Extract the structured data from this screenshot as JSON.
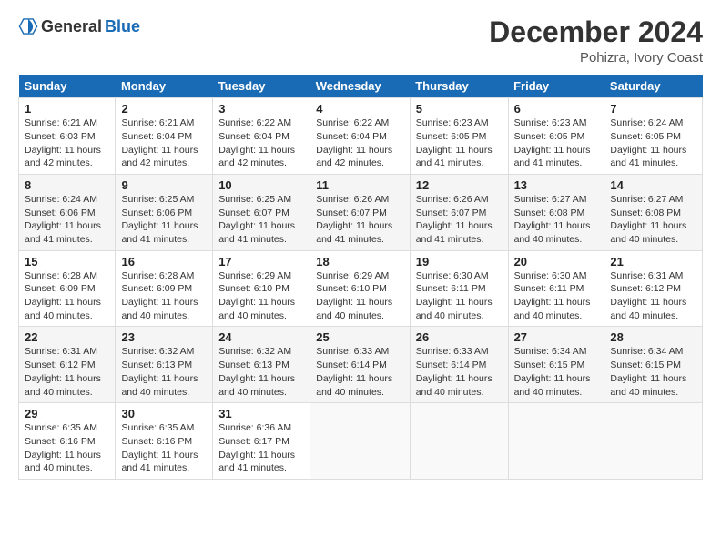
{
  "logo": {
    "general": "General",
    "blue": "Blue"
  },
  "title": "December 2024",
  "location": "Pohizra, Ivory Coast",
  "days_of_week": [
    "Sunday",
    "Monday",
    "Tuesday",
    "Wednesday",
    "Thursday",
    "Friday",
    "Saturday"
  ],
  "weeks": [
    [
      {
        "day": "1",
        "sunrise": "6:21 AM",
        "sunset": "6:03 PM",
        "daylight": "11 hours and 42 minutes."
      },
      {
        "day": "2",
        "sunrise": "6:21 AM",
        "sunset": "6:04 PM",
        "daylight": "11 hours and 42 minutes."
      },
      {
        "day": "3",
        "sunrise": "6:22 AM",
        "sunset": "6:04 PM",
        "daylight": "11 hours and 42 minutes."
      },
      {
        "day": "4",
        "sunrise": "6:22 AM",
        "sunset": "6:04 PM",
        "daylight": "11 hours and 42 minutes."
      },
      {
        "day": "5",
        "sunrise": "6:23 AM",
        "sunset": "6:05 PM",
        "daylight": "11 hours and 41 minutes."
      },
      {
        "day": "6",
        "sunrise": "6:23 AM",
        "sunset": "6:05 PM",
        "daylight": "11 hours and 41 minutes."
      },
      {
        "day": "7",
        "sunrise": "6:24 AM",
        "sunset": "6:05 PM",
        "daylight": "11 hours and 41 minutes."
      }
    ],
    [
      {
        "day": "8",
        "sunrise": "6:24 AM",
        "sunset": "6:06 PM",
        "daylight": "11 hours and 41 minutes."
      },
      {
        "day": "9",
        "sunrise": "6:25 AM",
        "sunset": "6:06 PM",
        "daylight": "11 hours and 41 minutes."
      },
      {
        "day": "10",
        "sunrise": "6:25 AM",
        "sunset": "6:07 PM",
        "daylight": "11 hours and 41 minutes."
      },
      {
        "day": "11",
        "sunrise": "6:26 AM",
        "sunset": "6:07 PM",
        "daylight": "11 hours and 41 minutes."
      },
      {
        "day": "12",
        "sunrise": "6:26 AM",
        "sunset": "6:07 PM",
        "daylight": "11 hours and 41 minutes."
      },
      {
        "day": "13",
        "sunrise": "6:27 AM",
        "sunset": "6:08 PM",
        "daylight": "11 hours and 40 minutes."
      },
      {
        "day": "14",
        "sunrise": "6:27 AM",
        "sunset": "6:08 PM",
        "daylight": "11 hours and 40 minutes."
      }
    ],
    [
      {
        "day": "15",
        "sunrise": "6:28 AM",
        "sunset": "6:09 PM",
        "daylight": "11 hours and 40 minutes."
      },
      {
        "day": "16",
        "sunrise": "6:28 AM",
        "sunset": "6:09 PM",
        "daylight": "11 hours and 40 minutes."
      },
      {
        "day": "17",
        "sunrise": "6:29 AM",
        "sunset": "6:10 PM",
        "daylight": "11 hours and 40 minutes."
      },
      {
        "day": "18",
        "sunrise": "6:29 AM",
        "sunset": "6:10 PM",
        "daylight": "11 hours and 40 minutes."
      },
      {
        "day": "19",
        "sunrise": "6:30 AM",
        "sunset": "6:11 PM",
        "daylight": "11 hours and 40 minutes."
      },
      {
        "day": "20",
        "sunrise": "6:30 AM",
        "sunset": "6:11 PM",
        "daylight": "11 hours and 40 minutes."
      },
      {
        "day": "21",
        "sunrise": "6:31 AM",
        "sunset": "6:12 PM",
        "daylight": "11 hours and 40 minutes."
      }
    ],
    [
      {
        "day": "22",
        "sunrise": "6:31 AM",
        "sunset": "6:12 PM",
        "daylight": "11 hours and 40 minutes."
      },
      {
        "day": "23",
        "sunrise": "6:32 AM",
        "sunset": "6:13 PM",
        "daylight": "11 hours and 40 minutes."
      },
      {
        "day": "24",
        "sunrise": "6:32 AM",
        "sunset": "6:13 PM",
        "daylight": "11 hours and 40 minutes."
      },
      {
        "day": "25",
        "sunrise": "6:33 AM",
        "sunset": "6:14 PM",
        "daylight": "11 hours and 40 minutes."
      },
      {
        "day": "26",
        "sunrise": "6:33 AM",
        "sunset": "6:14 PM",
        "daylight": "11 hours and 40 minutes."
      },
      {
        "day": "27",
        "sunrise": "6:34 AM",
        "sunset": "6:15 PM",
        "daylight": "11 hours and 40 minutes."
      },
      {
        "day": "28",
        "sunrise": "6:34 AM",
        "sunset": "6:15 PM",
        "daylight": "11 hours and 40 minutes."
      }
    ],
    [
      {
        "day": "29",
        "sunrise": "6:35 AM",
        "sunset": "6:16 PM",
        "daylight": "11 hours and 40 minutes."
      },
      {
        "day": "30",
        "sunrise": "6:35 AM",
        "sunset": "6:16 PM",
        "daylight": "11 hours and 41 minutes."
      },
      {
        "day": "31",
        "sunrise": "6:36 AM",
        "sunset": "6:17 PM",
        "daylight": "11 hours and 41 minutes."
      },
      null,
      null,
      null,
      null
    ]
  ]
}
